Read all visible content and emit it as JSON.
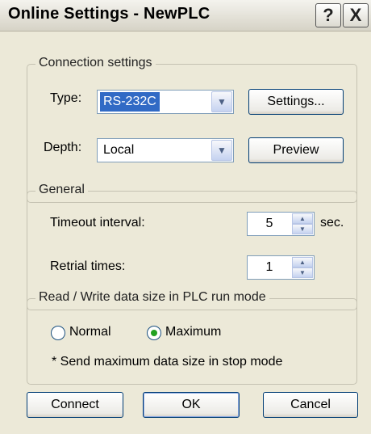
{
  "window": {
    "title": "Online Settings - NewPLC",
    "help_glyph": "?",
    "close_glyph": "X"
  },
  "connection": {
    "legend": "Connection settings",
    "type_label": "Type:",
    "type_value": "RS-232C",
    "depth_label": "Depth:",
    "depth_value": "Local",
    "settings_button": "Settings...",
    "preview_button": "Preview"
  },
  "general": {
    "legend": "General",
    "timeout_label": "Timeout interval:",
    "timeout_value": "5",
    "timeout_unit": "sec.",
    "retrial_label": "Retrial times:",
    "retrial_value": "1"
  },
  "readwrite": {
    "legend": "Read / Write data size in PLC run mode",
    "normal_label": "Normal",
    "maximum_label": "Maximum",
    "selected": "Maximum",
    "note": "* Send maximum data size in stop mode"
  },
  "footer": {
    "connect": "Connect",
    "ok": "OK",
    "cancel": "Cancel"
  }
}
